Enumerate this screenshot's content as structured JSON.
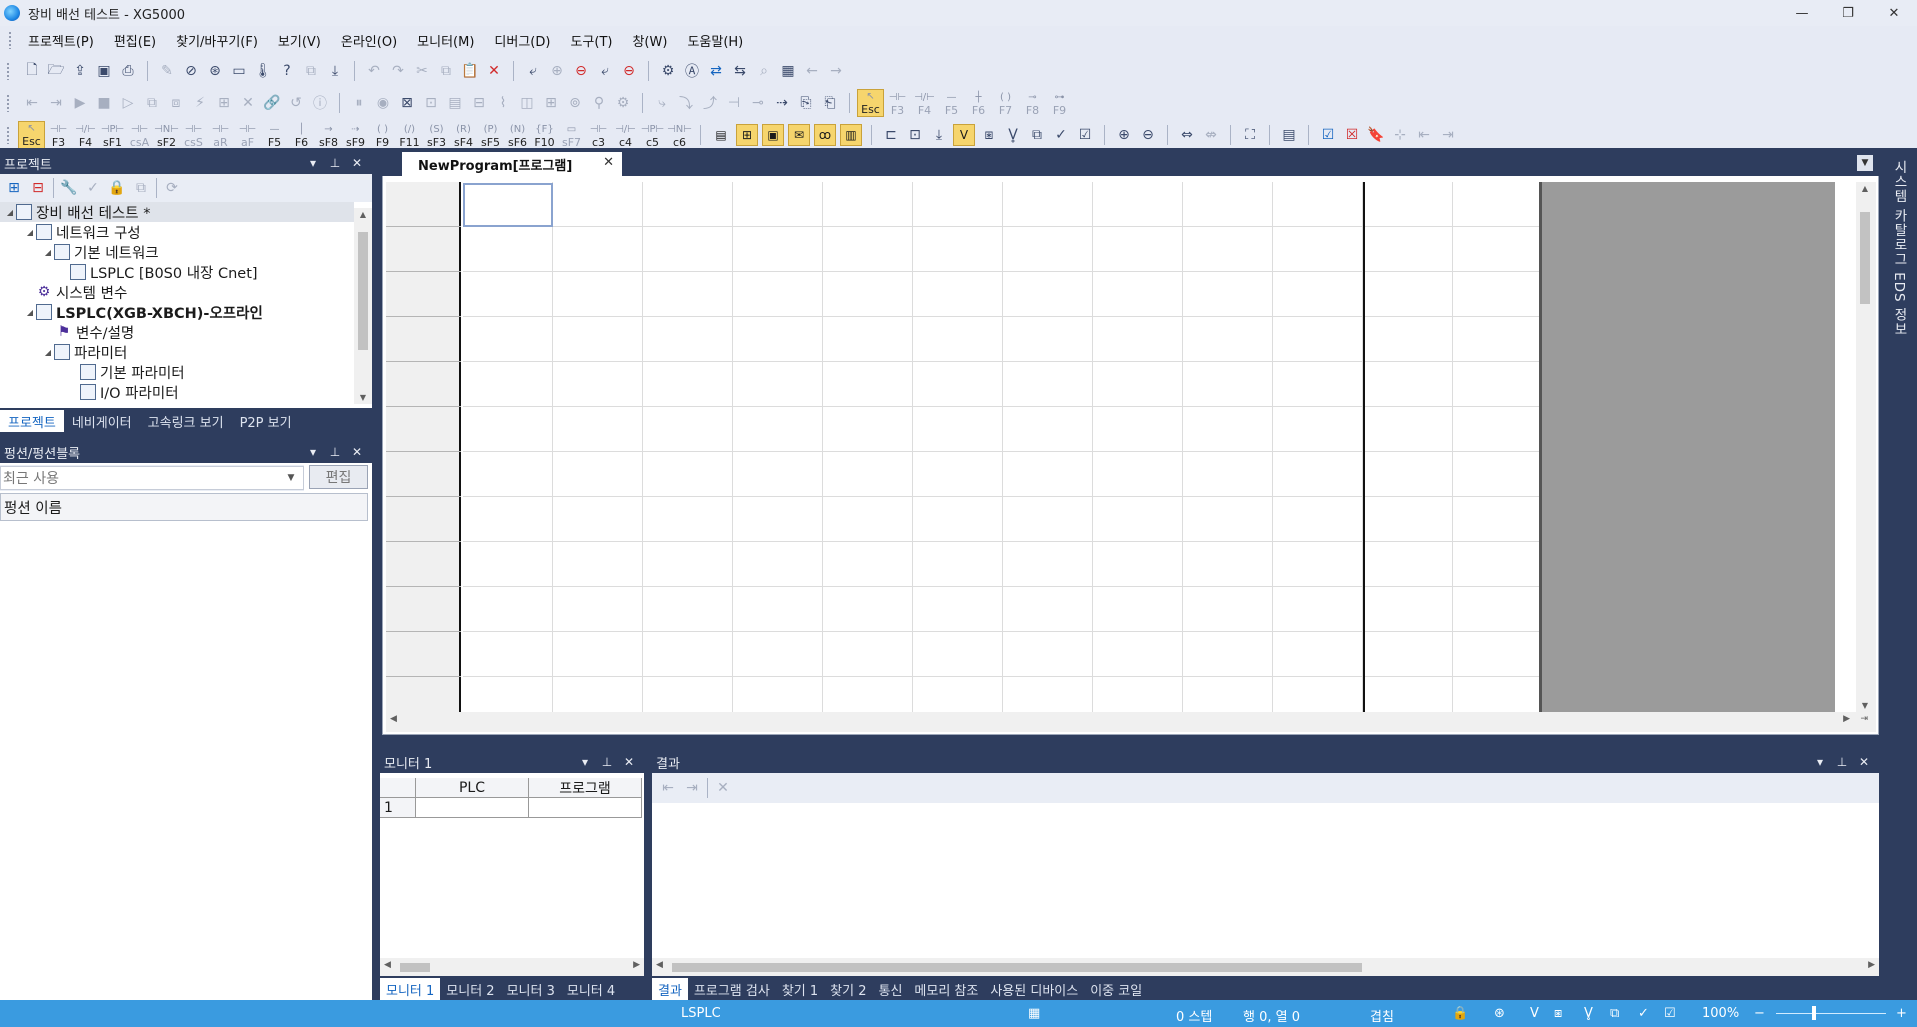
{
  "window": {
    "title": "장비 배선 테스트 - XG5000",
    "controls": [
      "—",
      "❐",
      "✕"
    ]
  },
  "menu": [
    "프로젝트(P)",
    "편집(E)",
    "찾기/바꾸기(F)",
    "보기(V)",
    "온라인(O)",
    "모니터(M)",
    "디버그(D)",
    "도구(T)",
    "창(W)",
    "도움말(H)"
  ],
  "fkeys_row2": [
    "Esc",
    "F3",
    "F4",
    "F5",
    "F6",
    "F7",
    "F8",
    "F9"
  ],
  "fkeys_row3": [
    "Esc",
    "F3",
    "F4",
    "sF1",
    "csA",
    "sF2",
    "csS",
    "aR",
    "aF",
    "F5",
    "F6",
    "sF8",
    "sF9",
    "F9",
    "F11",
    "sF3",
    "sF4",
    "sF5",
    "sF6",
    "F10",
    "sF7",
    "c3",
    "c4",
    "c5",
    "c6"
  ],
  "project_panel": {
    "title": "프로젝트",
    "tree": [
      {
        "label": "장비 배선 테스트 *",
        "level": 0,
        "bold": false,
        "icon": "project-icon"
      },
      {
        "label": "네트워크 구성",
        "level": 1,
        "bold": false,
        "icon": "network-icon"
      },
      {
        "label": "기본 네트워크",
        "level": 2,
        "bold": false,
        "icon": "network-basic-icon"
      },
      {
        "label": "LSPLC [B0S0 내장 Cnet]",
        "level": 3,
        "bold": false,
        "icon": "plc-node-icon"
      },
      {
        "label": "시스템 변수",
        "level": 1,
        "bold": false,
        "icon": "gear-icon"
      },
      {
        "label": "LSPLC(XGB-XBCH)-오프라인",
        "level": 1,
        "bold": true,
        "icon": "plc-icon"
      },
      {
        "label": "변수/설명",
        "level": 2,
        "bold": false,
        "icon": "variable-icon"
      },
      {
        "label": "파라미터",
        "level": 2,
        "bold": false,
        "icon": "parameter-icon"
      },
      {
        "label": "기본 파라미터",
        "level": 3,
        "bold": false,
        "icon": "document-icon"
      },
      {
        "label": "I/O 파라미터",
        "level": 3,
        "bold": false,
        "icon": "io-icon"
      }
    ],
    "tabs": [
      "프로젝트",
      "네비게이터",
      "고속링크 보기",
      "P2P 보기"
    ]
  },
  "function_panel": {
    "title": "펑션/펑션블록",
    "select_value": "최근 사용",
    "edit_label": "편집",
    "column_header": "펑션 이름"
  },
  "editor": {
    "tab_label": "NewProgram[프로그램]"
  },
  "monitor_panel": {
    "title": "모니터 1",
    "headers": [
      "",
      "PLC",
      "프로그램"
    ],
    "rows": [
      [
        "1",
        "",
        ""
      ]
    ],
    "tabs": [
      "모니터 1",
      "모니터 2",
      "모니터 3",
      "모니터 4"
    ]
  },
  "result_panel": {
    "title": "결과",
    "tabs": [
      "결과",
      "프로그램 검사",
      "찾기 1",
      "찾기 2",
      "통신",
      "메모리 참조",
      "사용된 디바이스",
      "이중 코일"
    ]
  },
  "right_strip": {
    "label": "시스템 카탈로그 EDS 정보"
  },
  "status": {
    "plc": "LSPLC",
    "steps": "0 스텝",
    "position": "행 0, 열 0",
    "overwrite": "겹침",
    "zoom": "100%",
    "zoom_minus": "−",
    "zoom_plus": "+"
  },
  "colors": {
    "dock_dark": "#2e3d5e",
    "status_bar": "#3a9be0",
    "fkey_active": "#f6d56d",
    "selection_cell": "#8aa3cf"
  }
}
